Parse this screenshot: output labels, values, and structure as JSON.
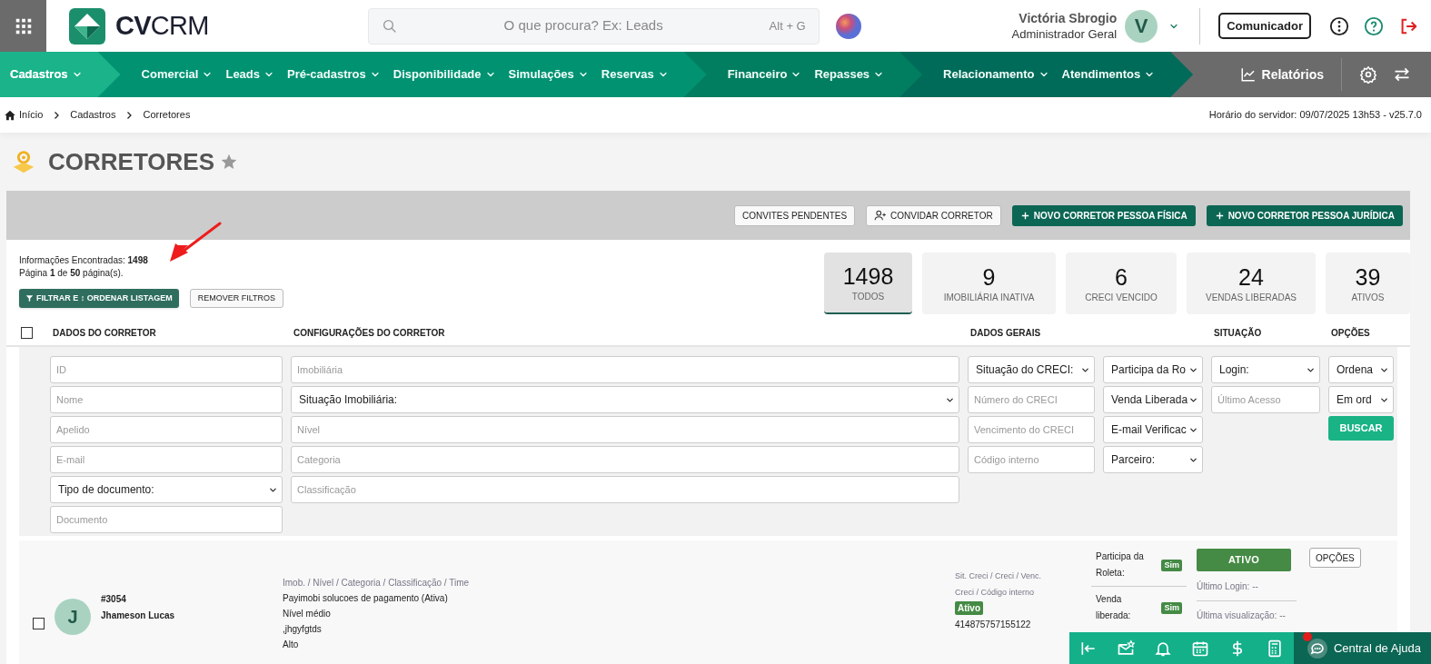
{
  "header": {
    "search_placeholder": "O que procura? Ex: Leads",
    "search_shortcut": "Alt + G",
    "logo_text_bold": "CV",
    "logo_text": "CRM",
    "user_name": "Victória Sbrogio",
    "user_role": "Administrador Geral",
    "user_initial": "V",
    "communicator": "Comunicador"
  },
  "nav": {
    "groups": [
      {
        "color": "#1ab38a",
        "items": [
          {
            "label": "Cadastros",
            "selected": true
          }
        ]
      },
      {
        "color": "#019272",
        "items": [
          {
            "label": "Comercial",
            "selected": false
          },
          {
            "label": "Leads",
            "selected": false
          },
          {
            "label": "Pré-cadastros",
            "selected": false
          },
          {
            "label": "Disponibilidade",
            "selected": false
          },
          {
            "label": "Simulações",
            "selected": false
          },
          {
            "label": "Reservas",
            "selected": false
          }
        ]
      },
      {
        "color": "#017e60",
        "items": [
          {
            "label": "Financeiro",
            "selected": false
          },
          {
            "label": "Repasses",
            "selected": false
          }
        ]
      },
      {
        "color": "#006b59",
        "items": [
          {
            "label": "Relacionamento",
            "selected": false
          },
          {
            "label": "Atendimentos",
            "selected": false
          }
        ]
      }
    ],
    "reports": "Relatórios"
  },
  "breadcrumb": [
    "Início",
    "Cadastros",
    "Corretores"
  ],
  "server_time": "Horário do servidor: 09/07/2025 13h53 - v25.7.0",
  "page_title": "CORRETORES",
  "toolbar_buttons": [
    {
      "kind": "plain",
      "label": "CONVITES PENDENTES"
    },
    {
      "kind": "invite",
      "label": "CONVIDAR CORRETOR"
    },
    {
      "kind": "add",
      "label": "NOVO CORRETOR PESSOA FÍSICA"
    },
    {
      "kind": "add",
      "label": "NOVO CORRETOR PESSOA JURÍDICA"
    }
  ],
  "summary": [
    "Informações Encontradas: **1498**",
    "Página **1** de **50** página(s)."
  ],
  "filter_button": "FILTRAR E ↕ ORDENAR LISTAGEM",
  "remove_filters": "REMOVER FILTROS",
  "stats": [
    {
      "value": "1498",
      "label": "TODOS",
      "selected": true
    },
    {
      "value": "9",
      "label": "IMOBILIÁRIA INATIVA",
      "selected": false
    },
    {
      "value": "6",
      "label": "CRECI VENCIDO",
      "selected": false
    },
    {
      "value": "24",
      "label": "VENDAS LIBERADAS",
      "selected": false
    },
    {
      "value": "39",
      "label": "ATIVOS",
      "selected": false
    }
  ],
  "table": {
    "select_all_checked": false,
    "columns": [
      {
        "label": "DADOS DO CORRETOR"
      },
      {
        "label": "CONFIGURAÇÕES DO CORRETOR"
      },
      {
        "label": "DADOS GERAIS"
      },
      {
        "label": "SITUAÇÃO"
      },
      {
        "label": "OPÇÕES"
      }
    ]
  },
  "filters": [
    [
      {
        "kind": "input",
        "placeholder": "ID"
      },
      {
        "kind": "input",
        "placeholder": "Nome"
      },
      {
        "kind": "input",
        "placeholder": "Apelido"
      },
      {
        "kind": "input",
        "placeholder": "E-mail"
      },
      {
        "kind": "select",
        "value": "Tipo de documento:"
      },
      {
        "kind": "input",
        "placeholder": "Documento"
      }
    ],
    [
      {
        "kind": "input",
        "placeholder": "Imobiliária"
      },
      {
        "kind": "select",
        "value": "Situação Imobiliária:"
      },
      {
        "kind": "input",
        "placeholder": "Nível"
      },
      {
        "kind": "input",
        "placeholder": "Categoria"
      },
      {
        "kind": "input",
        "placeholder": "Classificação"
      }
    ],
    [
      {
        "kind": "select",
        "value": "Situação do CRECI:"
      },
      {
        "kind": "input",
        "placeholder": "Número do CRECI"
      },
      {
        "kind": "input",
        "placeholder": "Vencimento do CRECI"
      },
      {
        "kind": "input",
        "placeholder": "Código interno"
      }
    ],
    [
      {
        "kind": "select",
        "value": "Participa da Ro"
      },
      {
        "kind": "select",
        "value": "Venda Liberada"
      },
      {
        "kind": "select",
        "value": "E-mail Verificac"
      },
      {
        "kind": "select",
        "value": "Parceiro:"
      }
    ],
    [
      {
        "kind": "select",
        "value": "Login:"
      },
      {
        "kind": "input",
        "placeholder": "Último Acesso"
      }
    ],
    [
      {
        "kind": "select",
        "value": "Ordena"
      },
      {
        "kind": "select",
        "value": "Em ord"
      },
      {
        "kind": "button",
        "label": "BUSCAR"
      }
    ]
  ],
  "rows": [
    {
      "checked": false,
      "initial": "J",
      "id": "#3054",
      "name": "Jhameson Lucas",
      "config_label": "Imob. / Nível / Categoria / Classificação / Time",
      "config_lines": [
        "Payimobi solucoes de pagamento (Ativa)",
        "Nível médio",
        ",jhgyfgtds",
        "Alto"
      ],
      "general_label": "Sit. Creci / Creci / Venc. Creci / Código interno",
      "creci_status": "Ativo",
      "creci_number": "414875757155122",
      "flags": [
        {
          "label": "Participa da Roleta:",
          "value": "Sim"
        },
        {
          "label": "Venda liberada:",
          "value": "Sim"
        }
      ],
      "status": "ATIVO",
      "last_login": "Último Login: --",
      "last_view": "Última visualização: --",
      "options": "OPÇÕES"
    }
  ],
  "help": {
    "label": "Central de Ajuda",
    "notification": true
  }
}
